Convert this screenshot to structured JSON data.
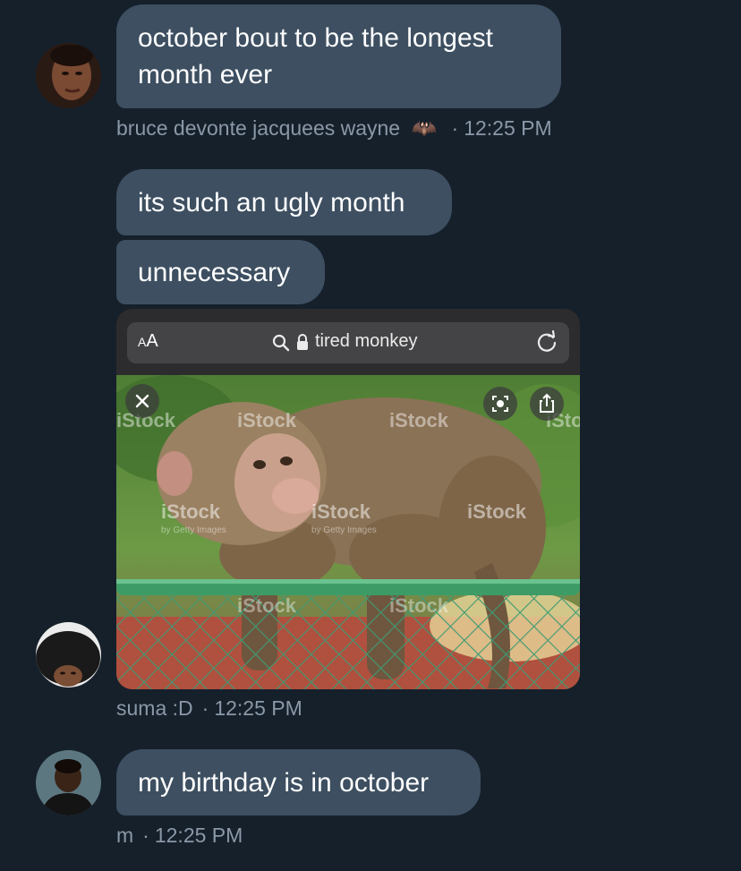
{
  "messages": [
    {
      "text_lines": [
        "october bout to be the longest",
        "month ever"
      ]
    },
    {
      "text": "its such an ugly month"
    },
    {
      "text": "unnecessary"
    },
    {
      "text": "my birthday is in october"
    }
  ],
  "meta": [
    {
      "sender": "bruce devonte jacquees wayne",
      "sender_emoji": "🦇",
      "time": "12:25 PM"
    },
    {
      "sender": "suma :D",
      "time": "12:25 PM"
    },
    {
      "sender": "m",
      "time": "12:25 PM"
    }
  ],
  "separator": "·",
  "screenshot": {
    "font_aa": "A",
    "font_aa_large": "A",
    "search_text": "tired monkey",
    "watermark": "iStock",
    "watermark_sub": "by Getty Images"
  },
  "colors": {
    "background": "#16202b",
    "bubble": "#3d4f61",
    "meta_text": "#8a98a7"
  },
  "icons": [
    "magnifier-icon",
    "lock-icon",
    "reload-icon",
    "close-icon",
    "lens-icon",
    "share-icon",
    "bat-emoji"
  ]
}
